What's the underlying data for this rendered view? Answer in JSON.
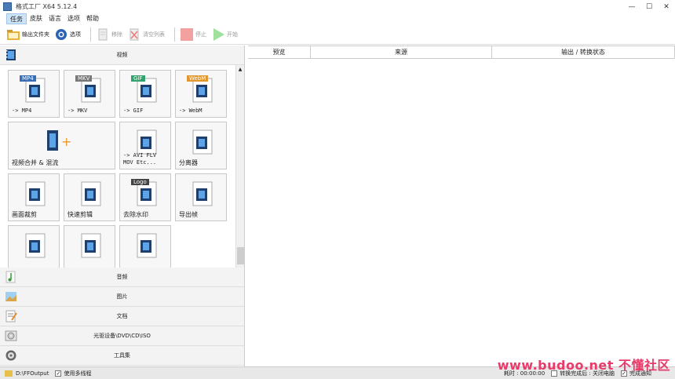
{
  "window": {
    "title": "格式工厂 X64 5.12.4",
    "min": "—",
    "max": "☐",
    "close": "✕"
  },
  "menu": [
    "任务",
    "皮肤",
    "语言",
    "选项",
    "帮助"
  ],
  "toolbar": {
    "output_folder": "输出文件夹",
    "options": "选项",
    "remove": "移除",
    "clear_list": "清空列表",
    "stop": "停止",
    "start": "开始"
  },
  "categories": {
    "video": "视频",
    "audio": "音频",
    "picture": "图片",
    "document": "文档",
    "rom": "光驱设备\\DVD\\CD\\ISO",
    "tools": "工具集"
  },
  "tiles": [
    {
      "label": "-> MP4",
      "badge": "MP4",
      "badge_color": "#3a6fb5",
      "mono": true
    },
    {
      "label": "-> MKV",
      "badge": "MKV",
      "badge_color": "#777",
      "mono": true
    },
    {
      "label": "-> GIF",
      "badge": "GIF",
      "badge_color": "#2fa36b",
      "mono": true
    },
    {
      "label": "-> WebM",
      "badge": "WebM",
      "badge_color": "#e2962b",
      "mono": true
    },
    {
      "label": "视频合并 & 混流",
      "wide": true
    },
    {
      "label": "-> AVI FLV\nMOV Etc...",
      "mono": true
    },
    {
      "label": "分离器"
    },
    {
      "label": "画面裁剪"
    },
    {
      "label": "快速剪辑"
    },
    {
      "label": "去除水印",
      "badge": "Logo"
    },
    {
      "label": "导出帧"
    },
    {
      "label": ""
    },
    {
      "label": ""
    },
    {
      "label": ""
    }
  ],
  "table": {
    "headers": [
      "预览",
      "来源",
      "输出 / 转换状态"
    ]
  },
  "status": {
    "path": "D:\\FFOutput",
    "multithread": "使用多线程",
    "elapsed": "耗时 : 00:00:00",
    "after_convert": "转换完成后 : 关闭电脑",
    "notify": "完成通知"
  },
  "watermark": "www.budoo.net 不懂社区"
}
